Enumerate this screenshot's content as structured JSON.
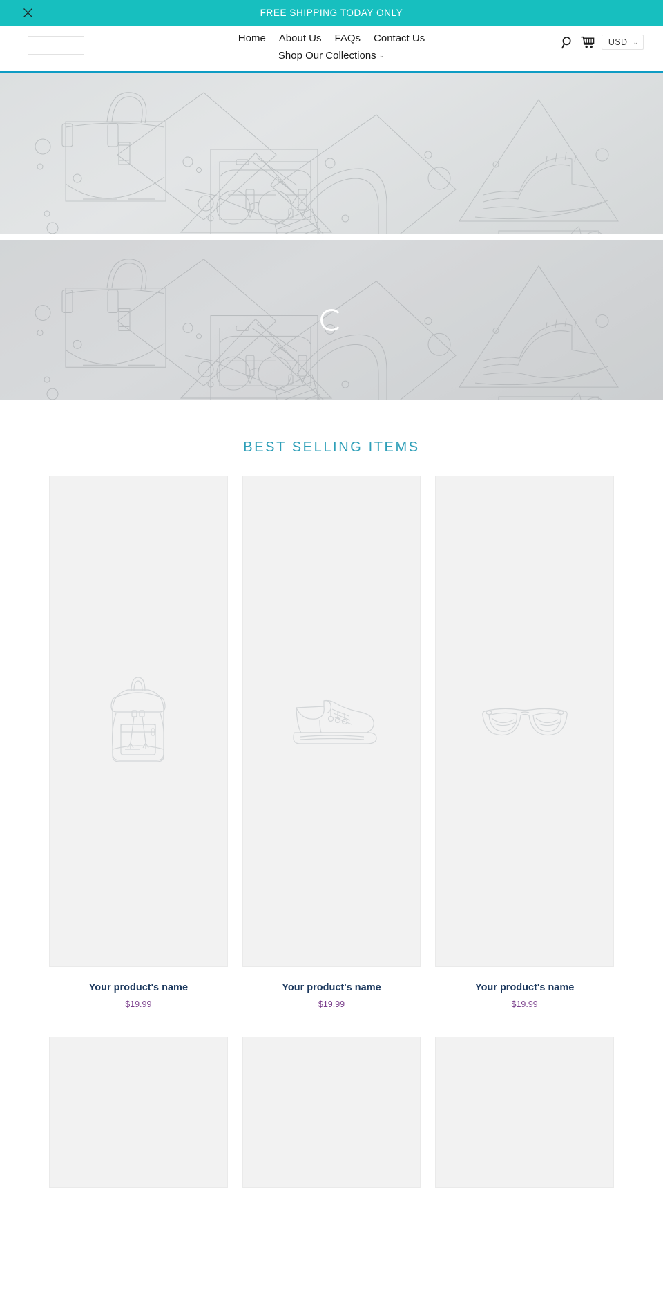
{
  "announcement": {
    "text": "FREE SHIPPING TODAY ONLY",
    "close_icon": "close-x-icon",
    "bg_color": "#17bfbf",
    "text_color": "#ffffff"
  },
  "header": {
    "logo_placeholder": "",
    "nav_primary": [
      {
        "label": "Home"
      },
      {
        "label": "About Us"
      },
      {
        "label": "FAQs"
      },
      {
        "label": "Contact Us"
      }
    ],
    "nav_secondary": [
      {
        "label": "Shop Our Collections",
        "caret": "∨"
      }
    ],
    "tools": {
      "search_icon": "search-magnifier-icon",
      "cart_icon": "shopping-cart-icon",
      "currency_value": "USD",
      "currency_caret": "∨"
    },
    "accent_border_color": "#0e9cc4"
  },
  "hero": {
    "banner_1": {
      "alt": "slideshow-placeholder-image-1"
    },
    "banner_2": {
      "alt": "slideshow-placeholder-image-2",
      "loading": true
    }
  },
  "best_selling": {
    "title": "BEST SELLING ITEMS",
    "title_color": "#2e9fb8",
    "products_row_1": [
      {
        "name": "Your product's name",
        "price": "$19.99",
        "image": "backpack-line-art"
      },
      {
        "name": "Your product's name",
        "price": "$19.99",
        "image": "sneaker-line-art"
      },
      {
        "name": "Your product's name",
        "price": "$19.99",
        "image": "eyeglasses-line-art"
      }
    ],
    "products_row_2": [
      {
        "name": "",
        "price": "",
        "image": ""
      },
      {
        "name": "",
        "price": "",
        "image": ""
      },
      {
        "name": "",
        "price": "",
        "image": ""
      }
    ]
  }
}
